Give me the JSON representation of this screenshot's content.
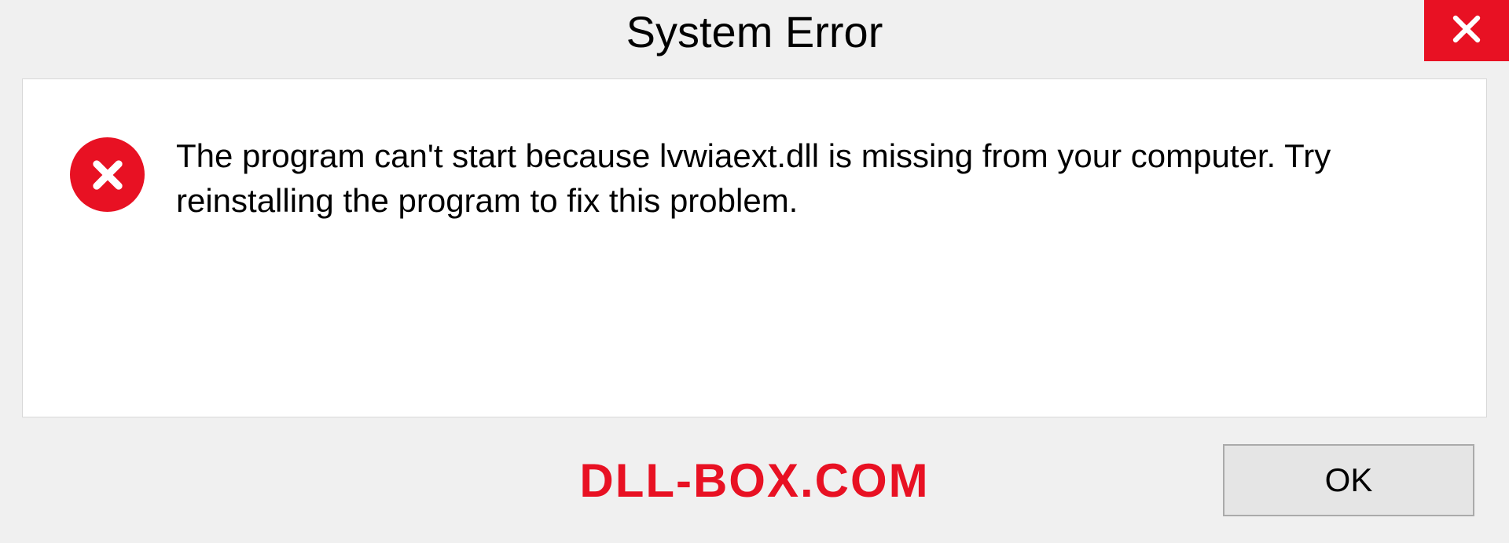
{
  "dialog": {
    "title": "System Error",
    "message": "The program can't start because lvwiaext.dll is missing from your computer. Try reinstalling the program to fix this problem.",
    "ok_label": "OK"
  },
  "branding": {
    "text": "DLL-BOX.COM"
  },
  "colors": {
    "error_red": "#e81123",
    "background": "#f0f0f0",
    "panel": "#ffffff"
  }
}
